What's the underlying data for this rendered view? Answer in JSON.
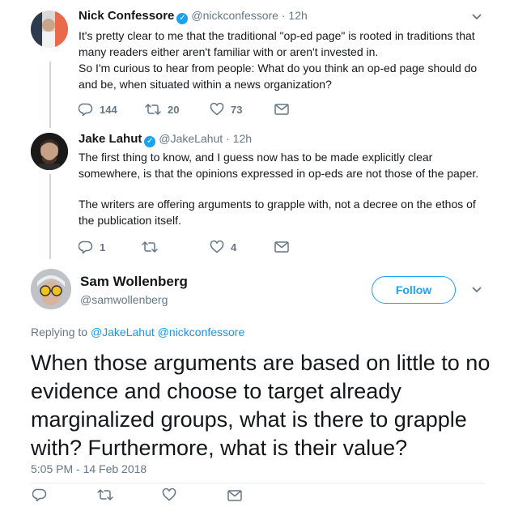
{
  "tweet1": {
    "name": "Nick Confessore",
    "handle": "@nickconfessore",
    "time": "12h",
    "lines": [
      "It's pretty clear to me that the traditional \"op-ed page\" is rooted in traditions that",
      "many readers either aren't familiar with or aren't invested in.",
      "So I'm curious to hear from people: What do you think an op-ed page should do",
      "and be, when situated within a news organization?"
    ],
    "replies": "144",
    "retweets": "20",
    "likes": "73"
  },
  "tweet2": {
    "name": "Jake Lahut",
    "handle": "@JakeLahut",
    "time": "12h",
    "lines": [
      "The first thing to know, and I guess now has to be made explicitly clear",
      "somewhere, is that the opinions expressed in op-eds are not those of the paper.",
      "The writers are offering arguments to grapple with, not a decree on the ethos of",
      "the publication itself."
    ],
    "replies": "1",
    "retweets": "",
    "likes": "4"
  },
  "main_tweet": {
    "name": "Sam Wollenberg",
    "handle": "@samwollenberg",
    "follow_label": "Follow",
    "replying_prefix": "Replying to",
    "replying_to_1": "@JakeLahut",
    "replying_to_2": "@nickconfessore",
    "text": "When those arguments are based on little to no evidence and choose to target already marginalized groups, what is there to grapple with? Furthermore, what is their value?",
    "timestamp": "5:05 PM - 14 Feb 2018"
  },
  "colors": {
    "accent": "#1da1f2",
    "muted": "#657786",
    "link": "#1b95e0"
  },
  "icons": [
    "reply-icon",
    "retweet-icon",
    "like-icon",
    "dm-icon",
    "chevron-down-icon",
    "verified-icon"
  ]
}
